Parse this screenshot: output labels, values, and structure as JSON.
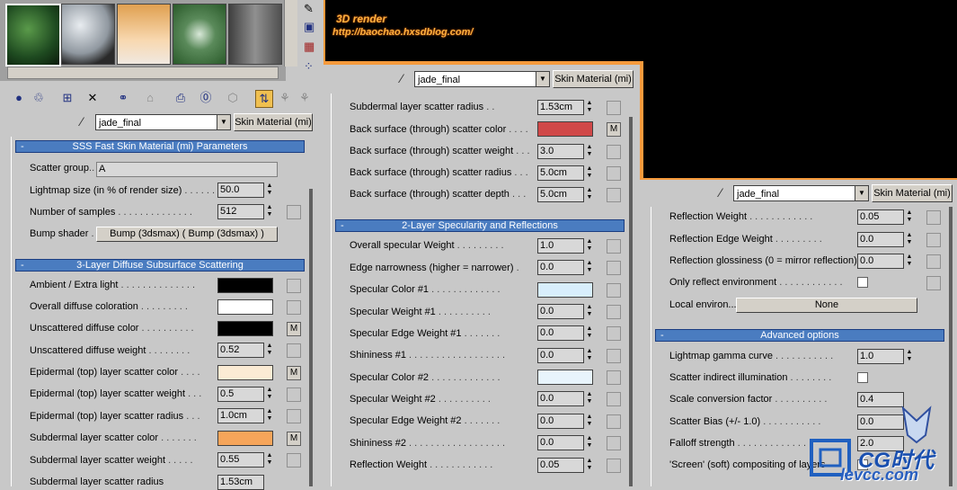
{
  "render": {
    "title": "3D render",
    "url": "http://baochao.hxsdblog.com/"
  },
  "material": {
    "name": "jade_final",
    "type": "Skin Material (mi)"
  },
  "left_panel": {
    "params_header": "SSS Fast Skin Material (mi) Parameters",
    "scatter_group_label": "Scatter group",
    "scatter_group_value": "A",
    "lightmap_label": "Lightmap size (in % of render size)",
    "lightmap_value": "50.0",
    "samples_label": "Number of samples",
    "samples_value": "512",
    "bump_label": "Bump shader",
    "bump_value": "Bump (3dsmax)  ( Bump (3dsmax) )",
    "diffuse_header": "3-Layer Diffuse Subsurface Scattering",
    "ambient_label": "Ambient / Extra light",
    "overall_diffuse_label": "Overall diffuse coloration",
    "unscattered_color_label": "Unscattered diffuse color",
    "unscattered_weight_label": "Unscattered diffuse weight",
    "unscattered_weight_value": "0.52",
    "epi_color_label": "Epidermal (top) layer scatter color",
    "epi_weight_label": "Epidermal (top) layer scatter weight",
    "epi_weight_value": "0.5",
    "epi_radius_label": "Epidermal (top) layer scatter radius",
    "epi_radius_value": "1.0cm",
    "sub_color_label": "Subdermal layer scatter color",
    "sub_weight_label": "Subdermal layer scatter weight",
    "sub_weight_value": "0.55",
    "sub_radius_label": "Subdermal layer scatter radius",
    "sub_radius_value": "1.53cm",
    "m": "M"
  },
  "mid_panel": {
    "sub_radius_label": "Subdermal layer scatter radius",
    "sub_radius_value": "1.53cm",
    "back_color_label": "Back surface (through) scatter color",
    "back_weight_label": "Back surface (through) scatter weight",
    "back_weight_value": "3.0",
    "back_radius_label": "Back surface (through) scatter radius",
    "back_radius_value": "5.0cm",
    "back_depth_label": "Back surface (through) scatter depth",
    "back_depth_value": "5.0cm",
    "spec_header": "2-Layer Specularity and Reflections",
    "overall_spec_label": "Overall specular Weight",
    "overall_spec_value": "1.0",
    "edge_narrow_label": "Edge narrowness (higher = narrower)",
    "edge_narrow_value": "0.0",
    "spec_color1_label": "Specular Color #1",
    "spec_weight1_label": "Specular Weight #1",
    "spec_weight1_value": "0.0",
    "spec_edge1_label": "Specular Edge Weight #1",
    "spec_edge1_value": "0.0",
    "shin1_label": "Shininess #1",
    "shin1_value": "0.0",
    "spec_color2_label": "Specular Color #2",
    "spec_weight2_label": "Specular Weight #2",
    "spec_weight2_value": "0.0",
    "spec_edge2_label": "Specular Edge Weight #2",
    "spec_edge2_value": "0.0",
    "shin2_label": "Shininess #2",
    "shin2_value": "0.0",
    "refl_weight_label": "Reflection Weight",
    "refl_weight_value": "0.05",
    "m": "M"
  },
  "right_panel": {
    "refl_weight_label": "Reflection Weight",
    "refl_weight_value": "0.05",
    "refl_edge_label": "Reflection Edge Weight",
    "refl_edge_value": "0.0",
    "refl_gloss_label": "Reflection glossiness (0 = mirror reflection)",
    "refl_gloss_value": "0.0",
    "only_reflect_label": "Only reflect environment",
    "local_env_label": "Local environ...",
    "local_env_value": "None",
    "adv_header": "Advanced options",
    "gamma_label": "Lightmap gamma curve",
    "gamma_value": "1.0",
    "scatter_indirect_label": "Scatter indirect illumination",
    "scale_conv_label": "Scale conversion factor",
    "scale_conv_value": "0.4",
    "scatter_bias_label": "Scatter Bias (+/- 1.0)",
    "scatter_bias_value": "0.0",
    "falloff_label": "Falloff strength",
    "falloff_value": "2.0",
    "screen_label": "'Screen' (soft) compositing of layers"
  },
  "watermark": {
    "text": "CG时代",
    "subtext": "levcc.com"
  },
  "colors": {
    "ambient": "#000000",
    "overall_diffuse": "#ffffff",
    "unscattered": "#000000",
    "epidermal": "#fbebd4",
    "subdermal": "#f6a55a",
    "back_surface": "#d04848",
    "spec1": "#d8eefc",
    "spec2": "#e8f4fc",
    "render_border": "#f59a3c"
  }
}
